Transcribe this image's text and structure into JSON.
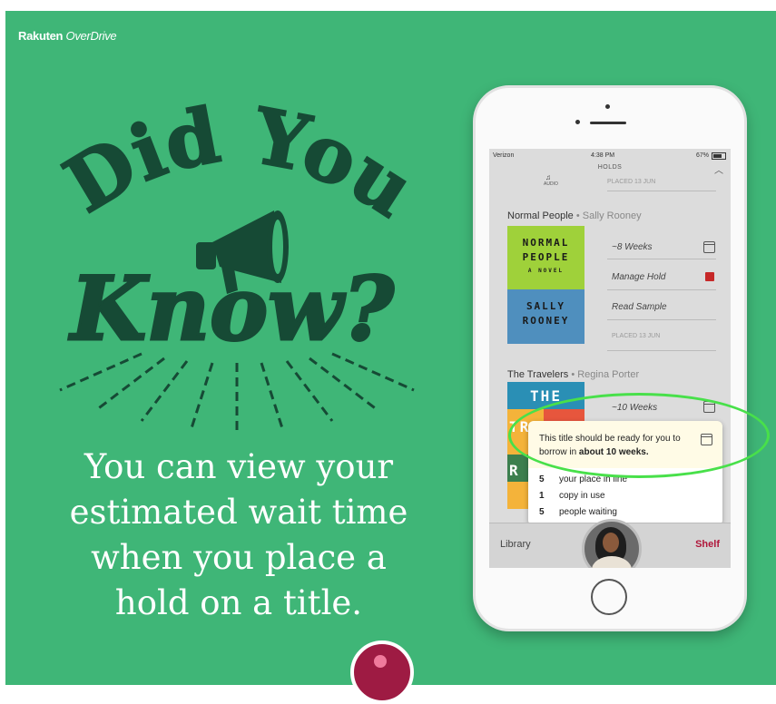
{
  "brand": {
    "name": "Rakuten",
    "product": "OverDrive"
  },
  "headline": {
    "line1": "Did You",
    "line2": "Know?"
  },
  "tagline": [
    "You can view your",
    "estimated wait time",
    "when you place a",
    "hold on a title."
  ],
  "phone": {
    "status": {
      "carrier": "Verizon",
      "time": "4:38 PM",
      "battery": "67%"
    },
    "screen_title": "HOLDS",
    "top_item": {
      "format_label": "AUDIO",
      "placed": "PLACED 13 JUN"
    },
    "books": [
      {
        "title": "Normal People",
        "author": "Sally Rooney",
        "cover_words": [
          "NORMAL",
          "PEOPLE",
          "A NOVEL",
          "SALLY",
          "ROONEY"
        ],
        "wait": "~8 Weeks",
        "manage": "Manage Hold",
        "sample": "Read Sample",
        "placed": "PLACED 13 JUN"
      },
      {
        "title": "The Travelers",
        "author": "Regina Porter",
        "cover_words": [
          "THE",
          "TR",
          "R"
        ],
        "wait": "~10 Weeks"
      }
    ],
    "popup": {
      "message": "This title should be ready for you to borrow in",
      "emphasis": "about 10 weeks.",
      "stats": [
        {
          "n": "5",
          "label": "your place in line"
        },
        {
          "n": "1",
          "label": "copy in use"
        },
        {
          "n": "5",
          "label": "people waiting"
        }
      ]
    },
    "tabs": {
      "left": "Library",
      "right": "Shelf"
    }
  },
  "colors": {
    "background": "#3fb677",
    "ink": "#164a35",
    "highlight": "#48e04a",
    "shelf": "#b0163a"
  }
}
